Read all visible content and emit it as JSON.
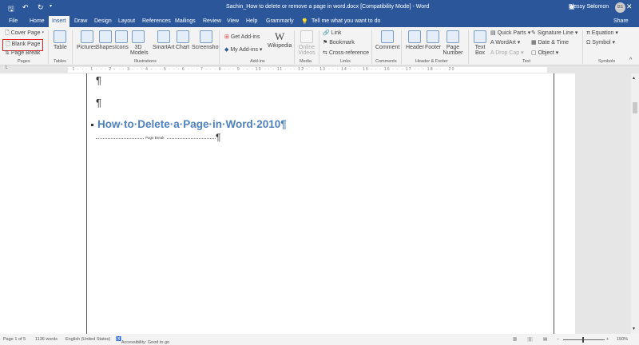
{
  "titlebar": {
    "title": "Sachin_How to delete or remove a page in word.docx [Compatibility Mode] - Word",
    "user": "Blessy Solomon",
    "initials": "BS"
  },
  "tabs": [
    "File",
    "Home",
    "Insert",
    "Draw",
    "Design",
    "Layout",
    "References",
    "Mailings",
    "Review",
    "View",
    "Help",
    "Grammarly"
  ],
  "tell_me": "Tell me what you want to do",
  "share": "Share",
  "ribbon": {
    "pages": {
      "cover": "Cover Page",
      "blank": "Blank Page",
      "break": "Page Break",
      "label": "Pages"
    },
    "tables": {
      "table": "Table",
      "label": "Tables"
    },
    "illustrations": {
      "pictures": "Pictures",
      "shapes": "Shapes",
      "icons": "Icons",
      "models": "3D Models",
      "smartart": "SmartArt",
      "chart": "Chart",
      "screenshot": "Screenshot",
      "label": "Illustrations"
    },
    "addins": {
      "get": "Get Add-ins",
      "my": "My Add-ins",
      "wiki": "Wikipedia",
      "label": "Add-ins"
    },
    "media": {
      "online": "Online Videos",
      "label": "Media"
    },
    "links": {
      "link": "Link",
      "bookmark": "Bookmark",
      "xref": "Cross-reference",
      "label": "Links"
    },
    "comments": {
      "comment": "Comment",
      "label": "Comments"
    },
    "hf": {
      "header": "Header",
      "footer": "Footer",
      "pagenum": "Page Number",
      "label": "Header & Footer"
    },
    "text": {
      "textbox": "Text Box",
      "quickparts": "Quick Parts",
      "wordart": "WordArt",
      "dropcap": "Drop Cap",
      "sigline": "Signature Line",
      "datetime": "Date & Time",
      "object": "Object",
      "label": "Text"
    },
    "symbols": {
      "equation": "Equation",
      "symbol": "Symbol",
      "label": "Symbols"
    }
  },
  "ruler": "· 1 · · · 1 · · · 2 · · · 3 · · · 4 · · · 5 · · · 6 · · · 7 · · · 8 · · · 9 · · · 10 · · · 11 · · · 12 · · · 13 · · · 14 · · · 15 · · · 16 · · · 17 · · · 18 · · · 20",
  "doc": {
    "pilcrow": "¶",
    "heading": "How·to·Delete·a·Page·in·Word·2010¶",
    "page_break": "Page Break"
  },
  "status": {
    "page": "Page 1 of 5",
    "words": "1136 words",
    "lang": "English (United States)",
    "access": "Accessibility: Good to go",
    "zoom": "150%"
  }
}
